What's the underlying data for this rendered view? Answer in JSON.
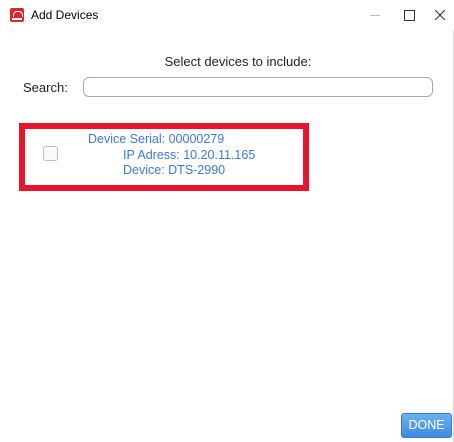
{
  "window": {
    "title": "Add Devices",
    "icon": "app-logo-icon",
    "controls": [
      "minimize-icon",
      "maximize-icon",
      "close-icon"
    ]
  },
  "dialog": {
    "prompt": "Select devices to include:",
    "search": {
      "label": "Search:",
      "value": "",
      "placeholder": ""
    },
    "devices": [
      {
        "checked": false,
        "serial_line": "Device Serial: 00000279",
        "ip_line": "IP Adress: 10.20.11.165",
        "device_line": "Device: DTS-2990",
        "highlighted": true
      }
    ],
    "done_label": "DONE"
  },
  "colors": {
    "accent": "#3d8ce0",
    "device_text": "#3a7ad9",
    "highlight_border": "#e8142d",
    "app_icon": "#d9272e"
  }
}
